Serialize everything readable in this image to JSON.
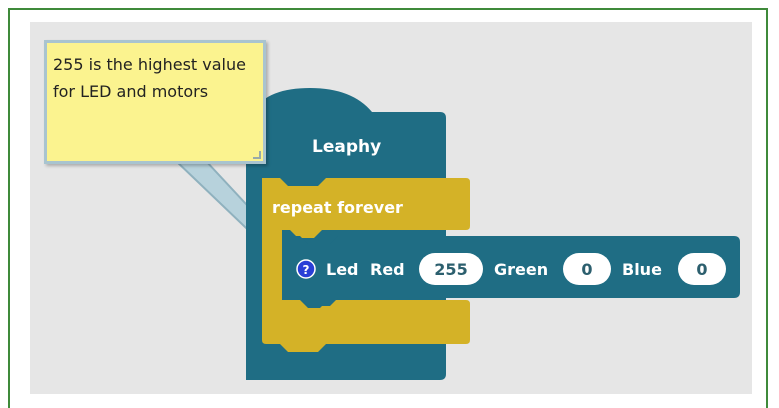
{
  "tooltip": {
    "text": "255 is the highest value for LED and motors"
  },
  "blocks": {
    "root_label": "Leaphy",
    "loop_label": "repeat forever",
    "help_glyph": "?",
    "led_block": {
      "label": "Led",
      "red_label": "Red",
      "red_value": "255",
      "green_label": "Green",
      "green_value": "0",
      "blue_label": "Blue",
      "blue_value": "0"
    }
  },
  "colors": {
    "root_block": "#1f6d84",
    "loop_block": "#d4b227",
    "led_block": "#1f6d84",
    "workspace": "#e6e6e6",
    "tooltip_bg": "#fbf38f",
    "help_icon": "#2a3fd6",
    "frame_border": "#3f8a3a"
  },
  "icons": {
    "help": "question-circle-icon"
  }
}
